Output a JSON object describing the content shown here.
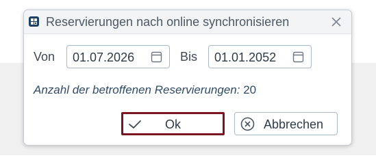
{
  "dialog": {
    "title": "Reservierungen nach online synchronisieren",
    "icon": "grid-app-icon",
    "close_icon": "close-icon"
  },
  "form": {
    "from_label": "Von",
    "from_value": "01.07.2026",
    "to_label": "Bis",
    "to_value": "01.01.2052",
    "calendar_icon": "calendar-icon"
  },
  "info": {
    "label": "Anzahl der betroffenen Reservierungen:",
    "count": "20"
  },
  "buttons": {
    "ok_label": "Ok",
    "ok_icon": "checkmark-icon",
    "cancel_label": "Abbrechen",
    "cancel_icon": "x-circle-icon"
  },
  "colors": {
    "accent_border": "#7a1420",
    "icon_blue": "#1d3f63",
    "text": "#2f3a47"
  }
}
